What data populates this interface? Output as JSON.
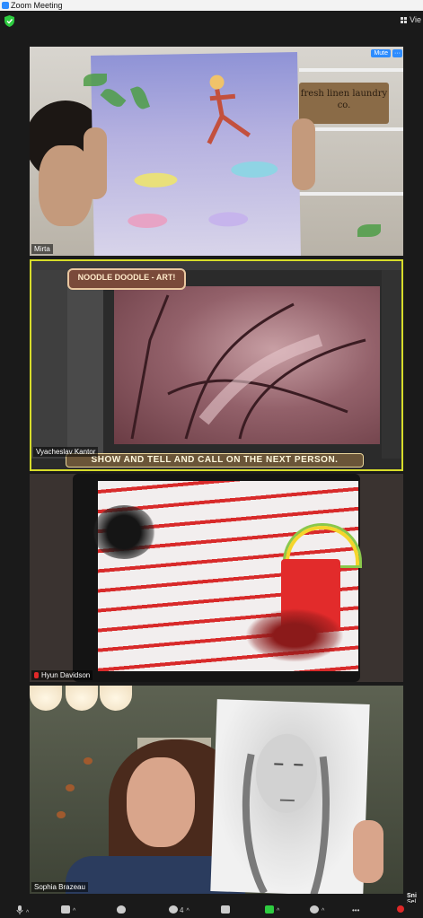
{
  "window": {
    "title": "Zoom Meeting"
  },
  "topbar": {
    "view_label": "Vie"
  },
  "participants": [
    {
      "name": "Mirta",
      "mute_label": "Mute",
      "more_label": "···"
    },
    {
      "name": "Vyacheslav Kantor",
      "banner_text": "NOODLE DOODLE - ART!",
      "caption_text": "SHOW AND TELL AND CALL ON THE NEXT PERSON."
    },
    {
      "name": "Hyun Davidson"
    },
    {
      "name": "Sophia Brazeau"
    }
  ],
  "tile1": {
    "sign_text": "fresh linen laundry co."
  },
  "toolbar": {
    "participants_count": "4",
    "side_user_label": "Sni",
    "side_user_sub": "Sel"
  },
  "colors": {
    "active_speaker_border": "#d7dc2a",
    "share_green": "#2ecc40",
    "accent_blue": "#2d8cff"
  }
}
